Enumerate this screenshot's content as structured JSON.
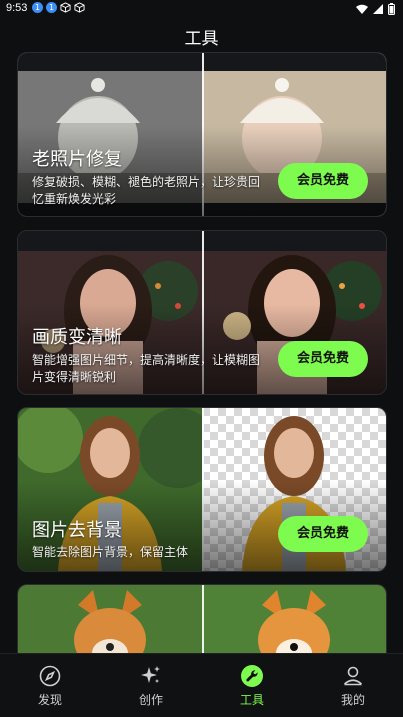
{
  "status_bar": {
    "time": "9:53",
    "notifications": [
      "1",
      "1"
    ]
  },
  "header": {
    "title": "工具"
  },
  "cards": [
    {
      "title": "老照片修复",
      "description": "修复破损、模糊、褪色的老照片，让珍贵回忆重新焕发光彩",
      "button": "会员免费"
    },
    {
      "title": "画质变清晰",
      "description": "智能增强图片细节，提高清晰度，让模糊图片变得清晰锐利",
      "button": "会员免费"
    },
    {
      "title": "图片去背景",
      "description": "智能去除图片背景，保留主体",
      "button": "会员免费"
    }
  ],
  "bottom_nav": [
    {
      "label": "发现",
      "icon": "compass-icon"
    },
    {
      "label": "创作",
      "icon": "sparkle-icon"
    },
    {
      "label": "工具",
      "icon": "wrench-icon",
      "active": true
    },
    {
      "label": "我的",
      "icon": "profile-icon"
    }
  ],
  "colors": {
    "accent": "#7dfb4e",
    "background": "#0e0f11"
  }
}
